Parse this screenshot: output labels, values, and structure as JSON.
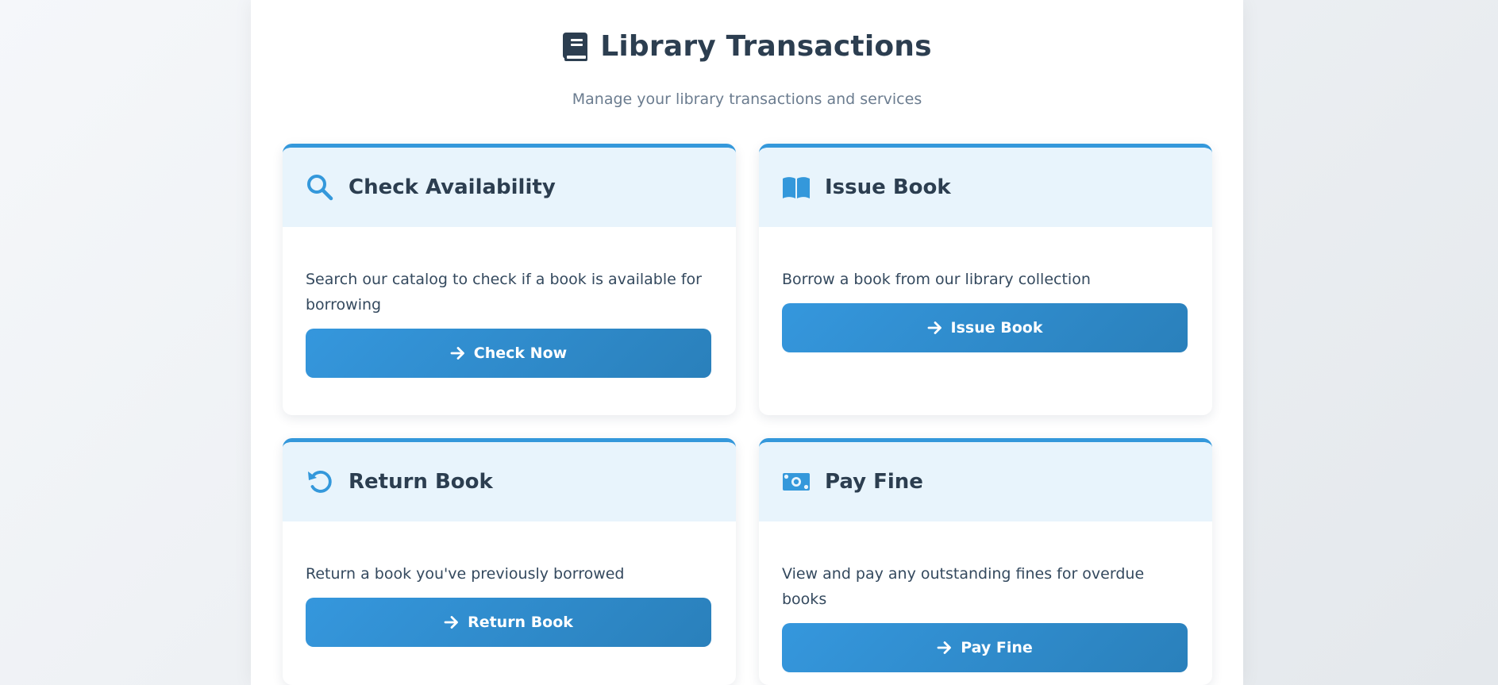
{
  "header": {
    "title": "Library Transactions",
    "subtitle": "Manage your library transactions and services",
    "icon": "book-icon"
  },
  "colors": {
    "accent": "#3498db",
    "heading": "#2c3e50",
    "card_header_bg": "#e8f4fc",
    "muted_text": "#6b7c8f"
  },
  "cards": [
    {
      "title": "Check Availability",
      "icon": "search-icon",
      "description": "Search our catalog to check if a book is available for borrowing",
      "button": "Check Now"
    },
    {
      "title": "Issue Book",
      "icon": "open-book-icon",
      "description": "Borrow a book from our library collection",
      "button": "Issue Book"
    },
    {
      "title": "Return Book",
      "icon": "undo-icon",
      "description": "Return a book you've previously borrowed",
      "button": "Return Book"
    },
    {
      "title": "Pay Fine",
      "icon": "money-bill-icon",
      "description": "View and pay any outstanding fines for overdue books",
      "button": "Pay Fine"
    }
  ]
}
